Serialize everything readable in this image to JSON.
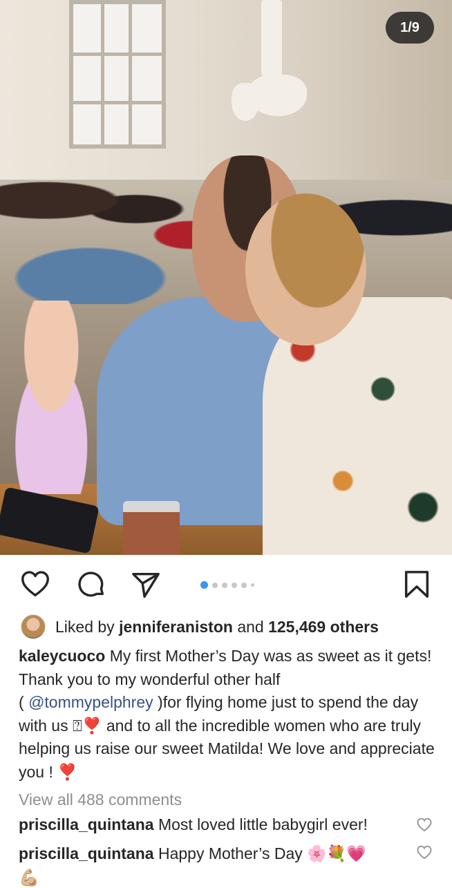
{
  "post": {
    "counter": "1/9",
    "carousel": {
      "total_dots": 6,
      "active_index": 0
    }
  },
  "likes": {
    "prefix": "Liked by",
    "user": "jenniferaniston",
    "conj": "and",
    "others": "125,469 others"
  },
  "caption": {
    "username": "kaleycuoco",
    "text_1": "My first Mother’s Day was as sweet as it gets! Thank you to my wonderful other half",
    "paren_open": "(",
    "mention": "@tommypelphrey",
    "text_2": ")for flying home just to spend the day with us",
    "missing_glyph": "⍰",
    "heart": "❣️",
    "text_3": "and to all the incredible women who are truly helping us raise our sweet Matilda! We love and appreciate you !",
    "heart_end": "❣️"
  },
  "view_all_comments": "View all 488 comments",
  "comments": [
    {
      "username": "priscilla_quintana",
      "text": "Most loved little babygirl ever!"
    },
    {
      "username": "priscilla_quintana",
      "text": "Happy Mother’s Day",
      "emojis": "🌸💐💗"
    }
  ],
  "partial_emoji": "💪🏼",
  "colors": {
    "link": "#385185",
    "muted": "#8e8e8e",
    "active_dot": "#3897f0",
    "heart": "#e0162b"
  }
}
